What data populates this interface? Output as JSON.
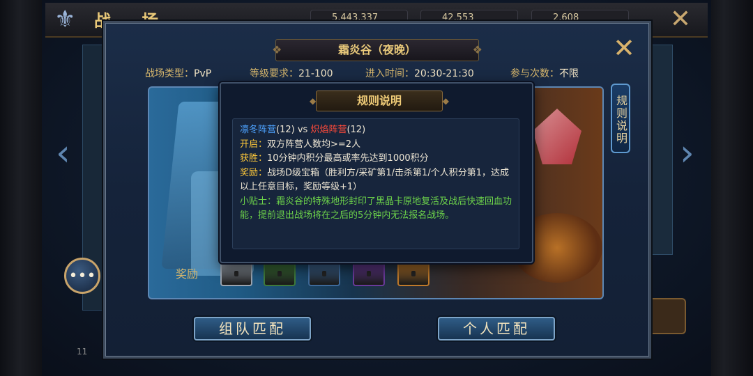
{
  "background": {
    "title": "战 场",
    "resources": [
      "5,443,337",
      "42,553",
      "2,608"
    ],
    "level_text": "11"
  },
  "dialog": {
    "title": "霜炎谷（夜晚）",
    "info": {
      "type_label": "战场类型：",
      "type_value": "PvP",
      "level_label": "等级要求：",
      "level_value": "21-100",
      "time_label": "进入时间：",
      "time_value": "20:30-21:30",
      "count_label": "参与次数：",
      "count_value": "不限"
    },
    "side_tab_label": "规则说明",
    "reward_label": "奖励",
    "reward_chests": [
      {
        "name": "silver-chest",
        "color": "#9aa4b0"
      },
      {
        "name": "green-chest",
        "color": "#3f7a3a"
      },
      {
        "name": "blue-chest",
        "color": "#3e6a9a"
      },
      {
        "name": "purple-chest",
        "color": "#6a3a9a"
      },
      {
        "name": "gold-chest",
        "color": "#c07a2a"
      }
    ],
    "team_button": "组队匹配",
    "solo_button": "个人匹配"
  },
  "rules": {
    "title": "规则说明",
    "faction_a": "凛冬阵营",
    "count_a": "(12)",
    "vs": " vs ",
    "faction_b": "炽焰阵营",
    "count_b": "(12)",
    "open_label": "开启：",
    "open_text": "双方阵营人数均>=2人",
    "win_label": "获胜：",
    "win_text": "10分钟内积分最高或率先达到1000积分",
    "reward_label": "奖励：",
    "reward_text": "战场D级宝箱（胜利方/采矿第1/击杀第1/个人积分第1，达成以上任意目标，奖励等级+1）",
    "tip_text": "小贴士：霜炎谷的特殊地形封印了黑晶卡原地复活及战后快速回血功能，提前退出战场将在之后的5分钟内无法报名战场。"
  },
  "colors": {
    "frost_faction": "#4ea3ff",
    "flame_faction": "#ff4a3a",
    "label_gold": "#ffc93a",
    "tip_green": "#6cd24a"
  }
}
